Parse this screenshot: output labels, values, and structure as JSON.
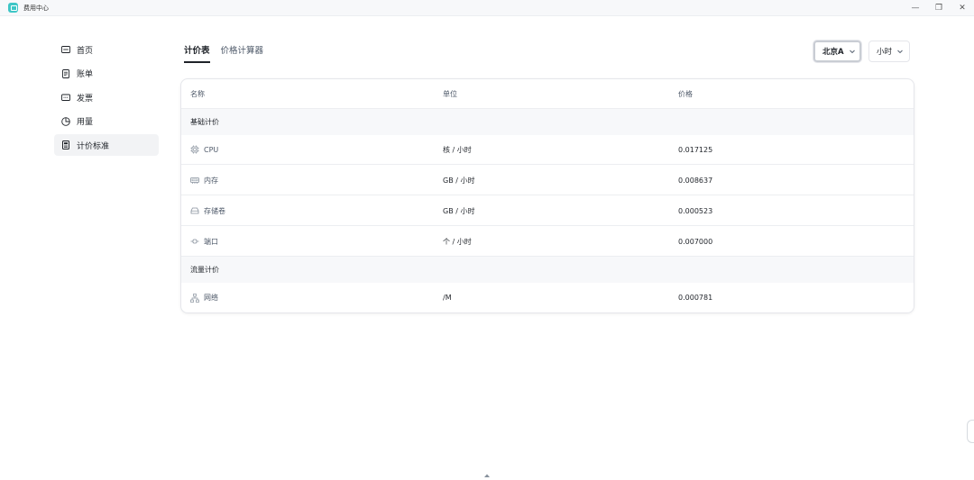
{
  "window": {
    "title": "费用中心",
    "controls": [
      "—",
      "❐",
      "✕"
    ]
  },
  "sidebar": {
    "items": [
      {
        "label": "首页",
        "icon": "home-card-icon",
        "active": false
      },
      {
        "label": "账单",
        "icon": "bill-doc-icon",
        "active": false
      },
      {
        "label": "发票",
        "icon": "invoice-ticket-icon",
        "active": false
      },
      {
        "label": "用量",
        "icon": "pie-chart-icon",
        "active": false
      },
      {
        "label": "计价标准",
        "icon": "pricing-doc-icon",
        "active": true
      }
    ]
  },
  "tabs": [
    {
      "label": "计价表",
      "active": true
    },
    {
      "label": "价格计算器",
      "active": false
    }
  ],
  "filters": {
    "region": "北京A",
    "unit": "小时"
  },
  "table": {
    "headers": [
      "名称",
      "单位",
      "价格"
    ],
    "groups": [
      {
        "title": "基础计价",
        "rows": [
          {
            "name": "CPU",
            "icon": "cpu-icon",
            "unit": "核 / 小时",
            "price": "0.017125"
          },
          {
            "name": "内存",
            "icon": "memory-icon",
            "unit": "GB / 小时",
            "price": "0.008637"
          },
          {
            "name": "存储卷",
            "icon": "storage-icon",
            "unit": "GB / 小时",
            "price": "0.000523"
          },
          {
            "name": "端口",
            "icon": "port-icon",
            "unit": "个 / 小时",
            "price": "0.007000"
          }
        ]
      },
      {
        "title": "流量计价",
        "rows": [
          {
            "name": "网络",
            "icon": "network-icon",
            "unit": "/M",
            "price": "0.000781"
          }
        ]
      }
    ]
  },
  "colors": {
    "accent_logo": "#3ec6c6",
    "text_primary": "#1f2329",
    "text_secondary": "#4e5969",
    "group_bg": "#f7f8fa",
    "border": "#e5e6eb"
  }
}
